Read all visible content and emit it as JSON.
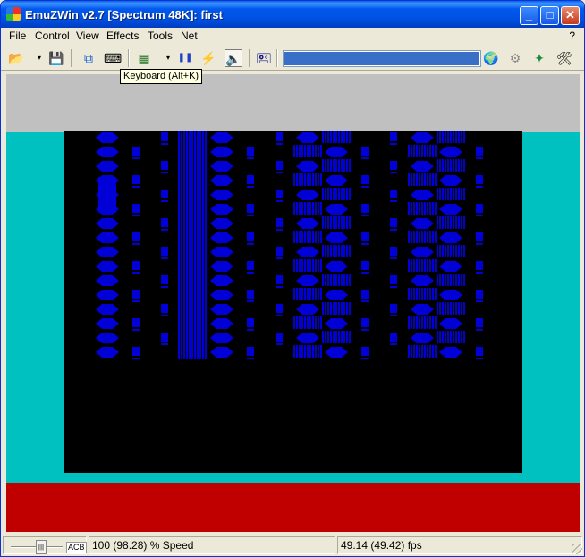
{
  "window": {
    "title": "EmuZWin v2.7 [Spectrum 48K]: first"
  },
  "titlebar_buttons": {
    "minimize": "_",
    "maximize": "□",
    "close": "✕"
  },
  "menu": {
    "items": [
      "File",
      "Control",
      "View",
      "Effects",
      "Tools",
      "Net"
    ],
    "help": "?"
  },
  "toolbar": {
    "tools": [
      {
        "name": "open-icon",
        "glyph": "📂"
      },
      {
        "name": "save-icon",
        "glyph": "💾"
      },
      {
        "name": "copy-icon",
        "glyph": "⧉"
      },
      {
        "name": "keyboard-icon",
        "glyph": "⌨"
      },
      {
        "name": "chip-icon",
        "glyph": "▦"
      },
      {
        "name": "pause-icon",
        "glyph": "❚❚"
      },
      {
        "name": "lightning-icon",
        "glyph": "⚡"
      },
      {
        "name": "speaker-icon",
        "glyph": "🔈"
      },
      {
        "name": "tape-icon",
        "glyph": "🖭"
      },
      {
        "name": "globe-icon",
        "glyph": "🌍"
      },
      {
        "name": "gear-icon",
        "glyph": "⚙"
      },
      {
        "name": "compass-icon",
        "glyph": "✦"
      },
      {
        "name": "tools-icon",
        "glyph": "🛠"
      }
    ],
    "dropdown_glyph": "▾",
    "progress_fraction": 1.0,
    "tooltip": "Keyboard (Alt+K)"
  },
  "colors": {
    "border_cyan": "#00C0C0",
    "border_red": "#C00000",
    "pattern_blue": "#0000D7",
    "paper_black": "#000000"
  },
  "status": {
    "acb_label": "ACB",
    "speed": "100 (98.28) % Speed",
    "fps": "49.14 (49.42) fps"
  }
}
